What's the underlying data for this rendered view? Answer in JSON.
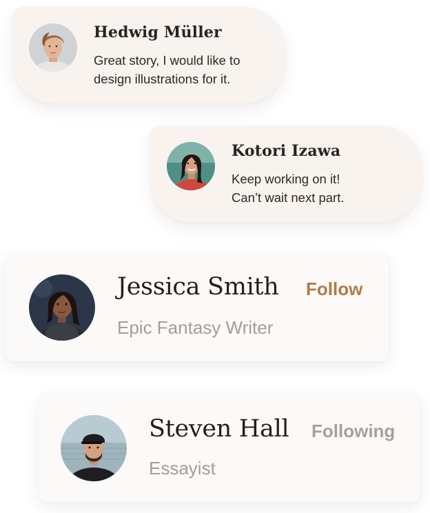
{
  "comments": [
    {
      "author": "Hedwig Müller",
      "message_lines": [
        "Great story, I would like to",
        "design illustrations for it."
      ]
    },
    {
      "author": "Kotori Izawa",
      "message_lines": [
        "Keep working on it!",
        "Can’t wait next part."
      ]
    }
  ],
  "profiles": [
    {
      "name": "Jessica Smith",
      "role": "Epic Fantasy Writer",
      "action_label": "Follow",
      "action_color": "#b07c45"
    },
    {
      "name": "Steven Hall",
      "role": "Essayist",
      "action_label": "Following",
      "action_color": "#a8a098"
    }
  ],
  "colors": {
    "bubble_background": "#f8f3ef",
    "card_background": "#fbfaf9",
    "primary_text": "#231f1c",
    "secondary_text": "#a49d96"
  }
}
